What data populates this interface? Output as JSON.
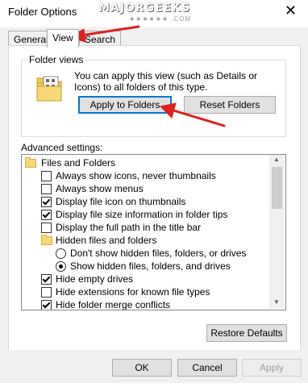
{
  "window": {
    "title": "Folder Options",
    "close_glyph": "✕",
    "watermark": "MAJORGEEKS",
    "watermark_sub": "★★★★★★ .COM"
  },
  "tabs": [
    {
      "label": "General",
      "active": false
    },
    {
      "label": "View",
      "active": true
    },
    {
      "label": "Search",
      "active": false
    }
  ],
  "folder_views": {
    "group_title": "Folder views",
    "description": "You can apply this view (such as Details or Icons) to all folders of this type.",
    "apply_button": "Apply to Folders",
    "reset_button": "Reset Folders"
  },
  "advanced": {
    "label": "Advanced settings:",
    "items": [
      {
        "type": "folder",
        "label": "Files and Folders",
        "level": 0
      },
      {
        "type": "checkbox",
        "label": "Always show icons, never thumbnails",
        "checked": false,
        "level": 1
      },
      {
        "type": "checkbox",
        "label": "Always show menus",
        "checked": false,
        "level": 1
      },
      {
        "type": "checkbox",
        "label": "Display file icon on thumbnails",
        "checked": true,
        "level": 1
      },
      {
        "type": "checkbox",
        "label": "Display file size information in folder tips",
        "checked": true,
        "level": 1
      },
      {
        "type": "checkbox",
        "label": "Display the full path in the title bar",
        "checked": false,
        "level": 1
      },
      {
        "type": "folder",
        "label": "Hidden files and folders",
        "level": 1
      },
      {
        "type": "radio",
        "label": "Don't show hidden files, folders, or drives",
        "selected": false,
        "level": 2
      },
      {
        "type": "radio",
        "label": "Show hidden files, folders, and drives",
        "selected": true,
        "level": 2
      },
      {
        "type": "checkbox",
        "label": "Hide empty drives",
        "checked": true,
        "level": 1
      },
      {
        "type": "checkbox",
        "label": "Hide extensions for known file types",
        "checked": false,
        "level": 1
      },
      {
        "type": "checkbox",
        "label": "Hide folder merge conflicts",
        "checked": true,
        "level": 1
      }
    ],
    "restore_button": "Restore Defaults"
  },
  "footer": {
    "ok": "OK",
    "cancel": "Cancel",
    "apply": "Apply"
  },
  "colors": {
    "annotation_arrow": "#e0201b",
    "focus_border": "#0078d7"
  }
}
